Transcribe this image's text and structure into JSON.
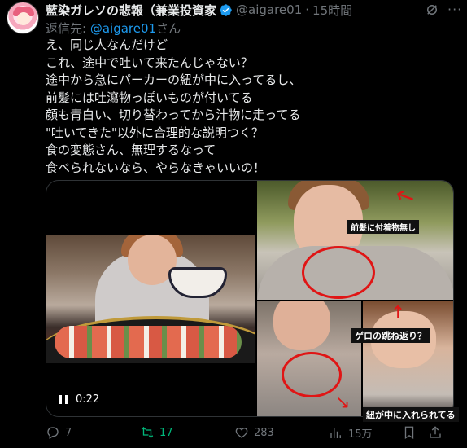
{
  "tweet": {
    "display_name": "藍染ガレソの悲報（兼業投資家",
    "handle": "@aigare01",
    "separator": "·",
    "time": "15時間",
    "reply_prefix": "返信先: ",
    "reply_mention": "@aigare01",
    "reply_suffix": "さん",
    "lines": [
      "え、同じ人なんだけど",
      "これ、途中で吐いて来たんじゃない？",
      "途中から急にパーカーの紐が中に入ってるし、",
      "前髪には吐瀉物っぽいものが付いてる",
      "顔も青白い、切り替わってから汁物に走ってる",
      "\"吐いてきた\"以外に合理的な説明つく？",
      "食の変態さん、無理するなって",
      "食べられないなら、やらなきゃいいの！"
    ]
  },
  "media": {
    "video_time": "0:22",
    "annotations": {
      "label1": "前髪に付着物無し",
      "label2": "ゲロの跳ね返り？",
      "label3": "紐が中に入れられてる"
    }
  },
  "actions": {
    "replies": "7",
    "retweets": "17",
    "likes": "283",
    "views": "15万"
  },
  "icons": {
    "verified": "verified-badge-icon",
    "grok": "grok-icon",
    "more": "more-icon",
    "reply": "reply-icon",
    "retweet": "retweet-icon",
    "like": "like-icon",
    "views": "views-icon",
    "bookmark": "bookmark-icon",
    "share": "share-icon",
    "pause": "pause-icon"
  },
  "colors": {
    "accent": "#1d9bf0",
    "retweet_active": "#00ba7c",
    "muted": "#71767b",
    "annotation_red": "#e01515"
  }
}
